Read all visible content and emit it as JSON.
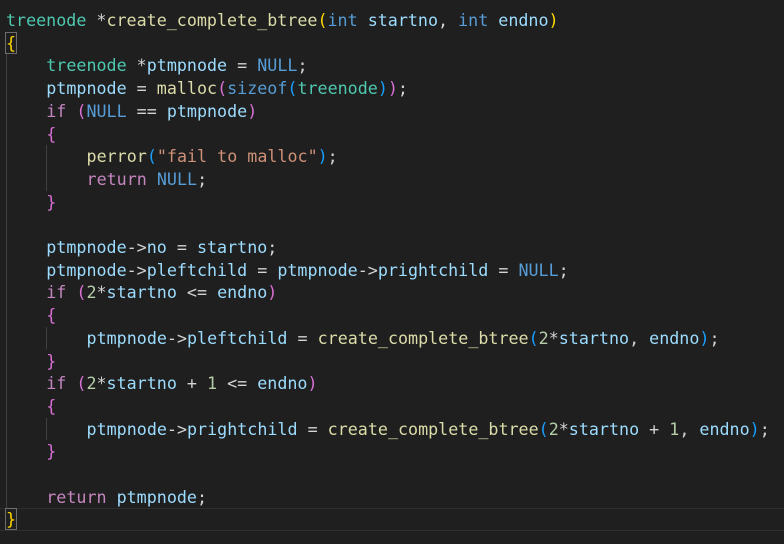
{
  "editor": {
    "language": "c",
    "colors": {
      "background": "#1f1f1f",
      "type": "#4ec9b0",
      "keyword": "#569cd6",
      "control": "#c586c0",
      "variable": "#9cdcfe",
      "function": "#dcdcaa",
      "string": "#ce9178",
      "number": "#b5cea8",
      "bracket1": "#ffd700",
      "bracket2": "#da70d6",
      "bracket3": "#179fff"
    },
    "lines": [
      {
        "indent": 0,
        "tokens": [
          {
            "t": "treenode",
            "c": "type"
          },
          {
            "t": " *",
            "c": "op"
          },
          {
            "t": "create_complete_btree",
            "c": "fn"
          },
          {
            "t": "(",
            "c": "p1"
          },
          {
            "t": "int",
            "c": "kw"
          },
          {
            "t": " ",
            "c": "op"
          },
          {
            "t": "startno",
            "c": "var"
          },
          {
            "t": ", ",
            "c": "op"
          },
          {
            "t": "int",
            "c": "kw"
          },
          {
            "t": " ",
            "c": "op"
          },
          {
            "t": "endno",
            "c": "var"
          },
          {
            "t": ")",
            "c": "p1"
          }
        ]
      },
      {
        "indent": 0,
        "tokens": [
          {
            "t": "{",
            "c": "p1",
            "match": true
          }
        ]
      },
      {
        "indent": 1,
        "tokens": [
          {
            "t": "treenode",
            "c": "type"
          },
          {
            "t": " *",
            "c": "op"
          },
          {
            "t": "ptmpnode",
            "c": "var"
          },
          {
            "t": " = ",
            "c": "op"
          },
          {
            "t": "NULL",
            "c": "kw"
          },
          {
            "t": ";",
            "c": "op"
          }
        ]
      },
      {
        "indent": 1,
        "tokens": [
          {
            "t": "ptmpnode",
            "c": "var"
          },
          {
            "t": " = ",
            "c": "op"
          },
          {
            "t": "malloc",
            "c": "fn"
          },
          {
            "t": "(",
            "c": "p2"
          },
          {
            "t": "sizeof",
            "c": "kw"
          },
          {
            "t": "(",
            "c": "p3"
          },
          {
            "t": "treenode",
            "c": "type"
          },
          {
            "t": ")",
            "c": "p3"
          },
          {
            "t": ")",
            "c": "p2"
          },
          {
            "t": ";",
            "c": "op"
          }
        ]
      },
      {
        "indent": 1,
        "tokens": [
          {
            "t": "if",
            "c": "ctrl"
          },
          {
            "t": " ",
            "c": "op"
          },
          {
            "t": "(",
            "c": "p2"
          },
          {
            "t": "NULL",
            "c": "kw"
          },
          {
            "t": " == ",
            "c": "op"
          },
          {
            "t": "ptmpnode",
            "c": "var"
          },
          {
            "t": ")",
            "c": "p2"
          }
        ]
      },
      {
        "indent": 1,
        "tokens": [
          {
            "t": "{",
            "c": "p2"
          }
        ]
      },
      {
        "indent": 2,
        "tokens": [
          {
            "t": "perror",
            "c": "fn"
          },
          {
            "t": "(",
            "c": "p3"
          },
          {
            "t": "\"fail to malloc\"",
            "c": "str"
          },
          {
            "t": ")",
            "c": "p3"
          },
          {
            "t": ";",
            "c": "op"
          }
        ]
      },
      {
        "indent": 2,
        "tokens": [
          {
            "t": "return",
            "c": "ctrl"
          },
          {
            "t": " ",
            "c": "op"
          },
          {
            "t": "NULL",
            "c": "kw"
          },
          {
            "t": ";",
            "c": "op"
          }
        ]
      },
      {
        "indent": 1,
        "tokens": [
          {
            "t": "}",
            "c": "p2"
          }
        ]
      },
      {
        "indent": 0,
        "tokens": []
      },
      {
        "indent": 1,
        "tokens": [
          {
            "t": "ptmpnode",
            "c": "var"
          },
          {
            "t": "->",
            "c": "op"
          },
          {
            "t": "no",
            "c": "var"
          },
          {
            "t": " = ",
            "c": "op"
          },
          {
            "t": "startno",
            "c": "var"
          },
          {
            "t": ";",
            "c": "op"
          }
        ]
      },
      {
        "indent": 1,
        "tokens": [
          {
            "t": "ptmpnode",
            "c": "var"
          },
          {
            "t": "->",
            "c": "op"
          },
          {
            "t": "pleftchild",
            "c": "var"
          },
          {
            "t": " = ",
            "c": "op"
          },
          {
            "t": "ptmpnode",
            "c": "var"
          },
          {
            "t": "->",
            "c": "op"
          },
          {
            "t": "prightchild",
            "c": "var"
          },
          {
            "t": " = ",
            "c": "op"
          },
          {
            "t": "NULL",
            "c": "kw"
          },
          {
            "t": ";",
            "c": "op"
          }
        ]
      },
      {
        "indent": 1,
        "tokens": [
          {
            "t": "if",
            "c": "ctrl"
          },
          {
            "t": " ",
            "c": "op"
          },
          {
            "t": "(",
            "c": "p2"
          },
          {
            "t": "2",
            "c": "num"
          },
          {
            "t": "*",
            "c": "op"
          },
          {
            "t": "startno",
            "c": "var"
          },
          {
            "t": " <= ",
            "c": "op"
          },
          {
            "t": "endno",
            "c": "var"
          },
          {
            "t": ")",
            "c": "p2"
          }
        ]
      },
      {
        "indent": 1,
        "tokens": [
          {
            "t": "{",
            "c": "p2"
          }
        ]
      },
      {
        "indent": 2,
        "tokens": [
          {
            "t": "ptmpnode",
            "c": "var"
          },
          {
            "t": "->",
            "c": "op"
          },
          {
            "t": "pleftchild",
            "c": "var"
          },
          {
            "t": " = ",
            "c": "op"
          },
          {
            "t": "create_complete_btree",
            "c": "fn"
          },
          {
            "t": "(",
            "c": "p3"
          },
          {
            "t": "2",
            "c": "num"
          },
          {
            "t": "*",
            "c": "op"
          },
          {
            "t": "startno",
            "c": "var"
          },
          {
            "t": ", ",
            "c": "op"
          },
          {
            "t": "endno",
            "c": "var"
          },
          {
            "t": ")",
            "c": "p3"
          },
          {
            "t": ";",
            "c": "op"
          }
        ]
      },
      {
        "indent": 1,
        "tokens": [
          {
            "t": "}",
            "c": "p2"
          }
        ]
      },
      {
        "indent": 1,
        "tokens": [
          {
            "t": "if",
            "c": "ctrl"
          },
          {
            "t": " ",
            "c": "op"
          },
          {
            "t": "(",
            "c": "p2"
          },
          {
            "t": "2",
            "c": "num"
          },
          {
            "t": "*",
            "c": "op"
          },
          {
            "t": "startno",
            "c": "var"
          },
          {
            "t": " + ",
            "c": "op"
          },
          {
            "t": "1",
            "c": "num"
          },
          {
            "t": " <= ",
            "c": "op"
          },
          {
            "t": "endno",
            "c": "var"
          },
          {
            "t": ")",
            "c": "p2"
          }
        ]
      },
      {
        "indent": 1,
        "tokens": [
          {
            "t": "{",
            "c": "p2"
          }
        ]
      },
      {
        "indent": 2,
        "tokens": [
          {
            "t": "ptmpnode",
            "c": "var"
          },
          {
            "t": "->",
            "c": "op"
          },
          {
            "t": "prightchild",
            "c": "var"
          },
          {
            "t": " = ",
            "c": "op"
          },
          {
            "t": "create_complete_btree",
            "c": "fn"
          },
          {
            "t": "(",
            "c": "p3"
          },
          {
            "t": "2",
            "c": "num"
          },
          {
            "t": "*",
            "c": "op"
          },
          {
            "t": "startno",
            "c": "var"
          },
          {
            "t": " + ",
            "c": "op"
          },
          {
            "t": "1",
            "c": "num"
          },
          {
            "t": ", ",
            "c": "op"
          },
          {
            "t": "endno",
            "c": "var"
          },
          {
            "t": ")",
            "c": "p3"
          },
          {
            "t": ";",
            "c": "op"
          }
        ]
      },
      {
        "indent": 1,
        "tokens": [
          {
            "t": "}",
            "c": "p2"
          }
        ]
      },
      {
        "indent": 0,
        "tokens": []
      },
      {
        "indent": 1,
        "tokens": [
          {
            "t": "return",
            "c": "ctrl"
          },
          {
            "t": " ",
            "c": "op"
          },
          {
            "t": "ptmpnode",
            "c": "var"
          },
          {
            "t": ";",
            "c": "op"
          }
        ]
      },
      {
        "indent": 0,
        "tokens": [
          {
            "t": "}",
            "c": "p1",
            "match": true
          }
        ],
        "cursor": true
      }
    ]
  }
}
